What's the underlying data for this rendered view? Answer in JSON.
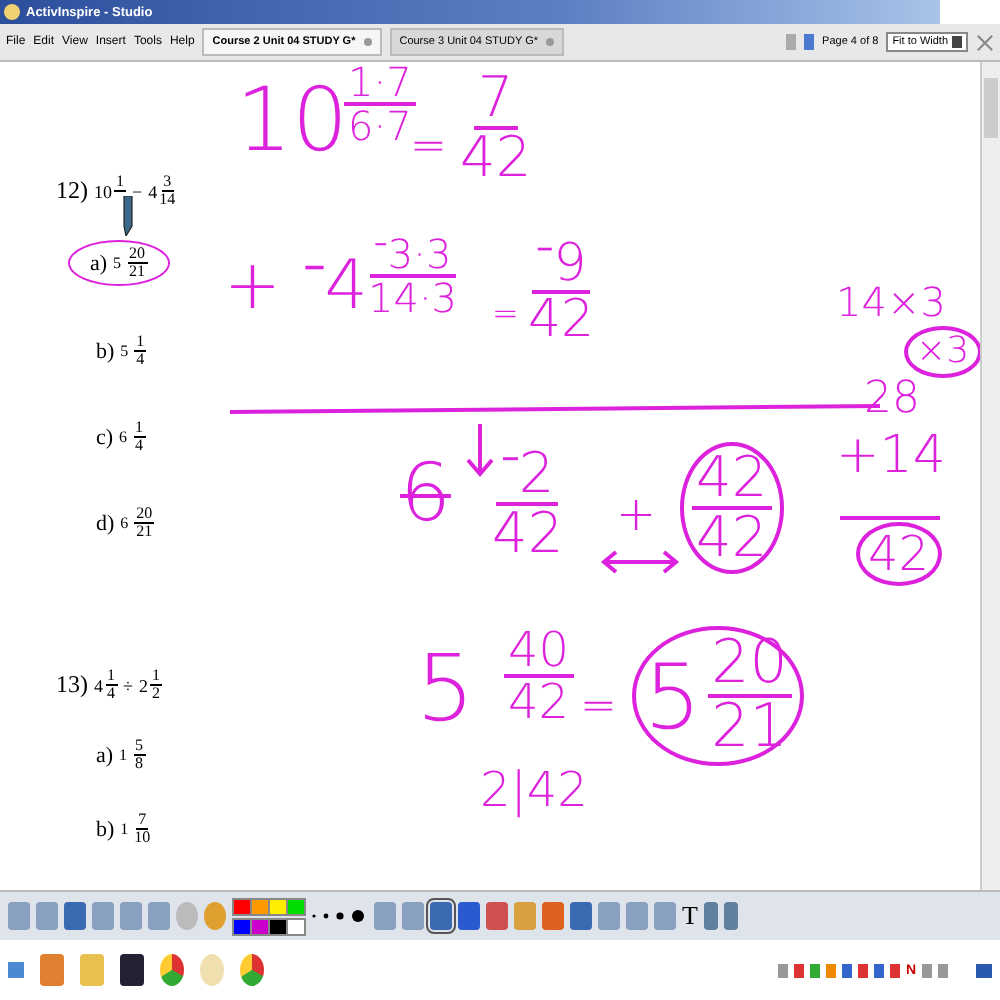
{
  "window": {
    "title": "ActivInspire - Studio"
  },
  "menu": [
    "File",
    "Edit",
    "View",
    "Insert",
    "Tools",
    "Help"
  ],
  "tabs": [
    {
      "label": "Course 2 Unit 04 STUDY G*",
      "selected": true
    },
    {
      "label": "Course 3 Unit 04 STUDY G*",
      "selected": false
    }
  ],
  "page_indicator": "Page 4 of 8",
  "zoom": {
    "value": "Fit to Width"
  },
  "questions": [
    {
      "number": "12)",
      "expression": [
        {
          "kind": "mixed",
          "whole": "10",
          "num": "1"
        },
        {
          "kind": "op",
          "text": "−"
        },
        {
          "kind": "mixed",
          "whole": "4",
          "num": "3",
          "den": "14"
        }
      ],
      "options": [
        {
          "letter": "a)",
          "whole": "5",
          "num": "20",
          "den": "21",
          "circled": true
        },
        {
          "letter": "b)",
          "whole": "5",
          "num": "1",
          "den": "4",
          "circled": false
        },
        {
          "letter": "c)",
          "whole": "6",
          "num": "1",
          "den": "4",
          "circled": false
        },
        {
          "letter": "d)",
          "whole": "6",
          "num": "20",
          "den": "21",
          "circled": false
        }
      ]
    },
    {
      "number": "13)",
      "expression": [
        {
          "kind": "mixed",
          "whole": "4",
          "num": "1",
          "den": "4"
        },
        {
          "kind": "op",
          "text": "÷"
        },
        {
          "kind": "mixed",
          "whole": "2",
          "num": "1",
          "den": "2"
        }
      ],
      "options": [
        {
          "letter": "a)",
          "whole": "1",
          "num": "5",
          "den": "8",
          "circled": false
        },
        {
          "letter": "b)",
          "whole": "1",
          "num": "7",
          "den": "10",
          "circled": false
        }
      ]
    }
  ],
  "ink": [
    {
      "kind": "text",
      "text": "10"
    },
    {
      "kind": "fraction",
      "num": "1·7",
      "den": "6·7"
    },
    {
      "kind": "text",
      "text": "="
    },
    {
      "kind": "fraction",
      "num": "7",
      "den": "42"
    },
    {
      "kind": "text",
      "text": "+ ⁻4"
    },
    {
      "kind": "fraction",
      "num": "⁻3·3",
      "den": "14·3"
    },
    {
      "kind": "text",
      "text": "="
    },
    {
      "kind": "fraction",
      "num": "⁻9",
      "den": "42"
    },
    {
      "kind": "text",
      "text": "14×3"
    },
    {
      "kind": "text",
      "text": "×3",
      "circled": true
    },
    {
      "kind": "text",
      "text": "28"
    },
    {
      "kind": "text",
      "text": "+14"
    },
    {
      "kind": "text",
      "text": "42",
      "circled": true
    },
    {
      "kind": "text",
      "text": "6",
      "struck": true
    },
    {
      "kind": "fraction",
      "num": "⁻2",
      "den": "42"
    },
    {
      "kind": "text",
      "text": "+"
    },
    {
      "kind": "fraction",
      "num": "42",
      "den": "42",
      "circled": true
    },
    {
      "kind": "text",
      "text": "5"
    },
    {
      "kind": "fraction",
      "num": "40",
      "den": "42"
    },
    {
      "kind": "text",
      "text": "="
    },
    {
      "kind": "mixed",
      "whole": "5",
      "num": "20",
      "den": "21",
      "circled": true
    },
    {
      "kind": "text",
      "text": "2|42"
    }
  ],
  "toolbar": {
    "palette": [
      {
        "color": "#ff0000"
      },
      {
        "color": "#ff9900"
      },
      {
        "color": "#ffee00"
      },
      {
        "color": "#00dd00"
      },
      {
        "color": "#0000ff"
      },
      {
        "color": "#cc00cc"
      },
      {
        "color": "#000000"
      },
      {
        "color": "#ffffff"
      }
    ],
    "text_tool": "T"
  },
  "tray": {
    "letter": "N"
  }
}
